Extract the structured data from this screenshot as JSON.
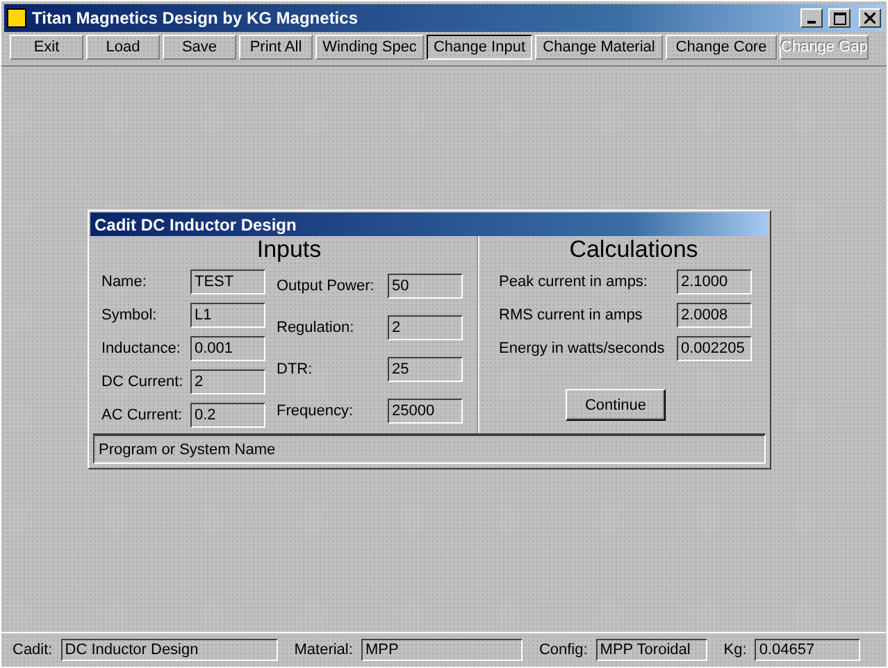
{
  "window": {
    "title": "Titan Magnetics Design by KG Magnetics"
  },
  "toolbar": [
    {
      "label": "Exit",
      "selected": false,
      "disabled": false
    },
    {
      "label": "Load",
      "selected": false,
      "disabled": false
    },
    {
      "label": "Save",
      "selected": false,
      "disabled": false
    },
    {
      "label": "Print All",
      "selected": false,
      "disabled": false
    },
    {
      "label": "Winding Spec",
      "selected": false,
      "disabled": false
    },
    {
      "label": "Change Input",
      "selected": true,
      "disabled": false
    },
    {
      "label": "Change Material",
      "selected": false,
      "disabled": false
    },
    {
      "label": "Change Core",
      "selected": false,
      "disabled": false
    },
    {
      "label": "Change Gap",
      "selected": false,
      "disabled": true
    }
  ],
  "dialog": {
    "title": "Cadit DC Inductor Design",
    "inputs": {
      "heading": "Inputs",
      "left": [
        {
          "label": "Name:",
          "value": "TEST"
        },
        {
          "label": "Symbol:",
          "value": "L1"
        },
        {
          "label": "Inductance:",
          "value": "0.001"
        },
        {
          "label": "DC Current:",
          "value": "2"
        },
        {
          "label": "AC Current:",
          "value": "0.2"
        }
      ],
      "right": [
        {
          "label": "Output Power:",
          "value": "50"
        },
        {
          "label": "Regulation:",
          "value": "2"
        },
        {
          "label": "DTR:",
          "value": "25"
        },
        {
          "label": "Frequency:",
          "value": "25000"
        }
      ]
    },
    "calculations": {
      "heading": "Calculations",
      "rows": [
        {
          "label": "Peak current in amps:",
          "value": "2.1000"
        },
        {
          "label": "RMS current in amps",
          "value": "2.0008"
        },
        {
          "label": "Energy in watts/seconds",
          "value": "0.002205"
        }
      ],
      "button": "Continue"
    },
    "status": "Program or System Name"
  },
  "status_bar": [
    {
      "label": "Cadit:",
      "value": "DC Inductor Design"
    },
    {
      "label": "Material:",
      "value": "MPP"
    },
    {
      "label": "Config:",
      "value": "MPP Toroidal"
    },
    {
      "label": "Kg:",
      "value": "0.04657"
    }
  ]
}
